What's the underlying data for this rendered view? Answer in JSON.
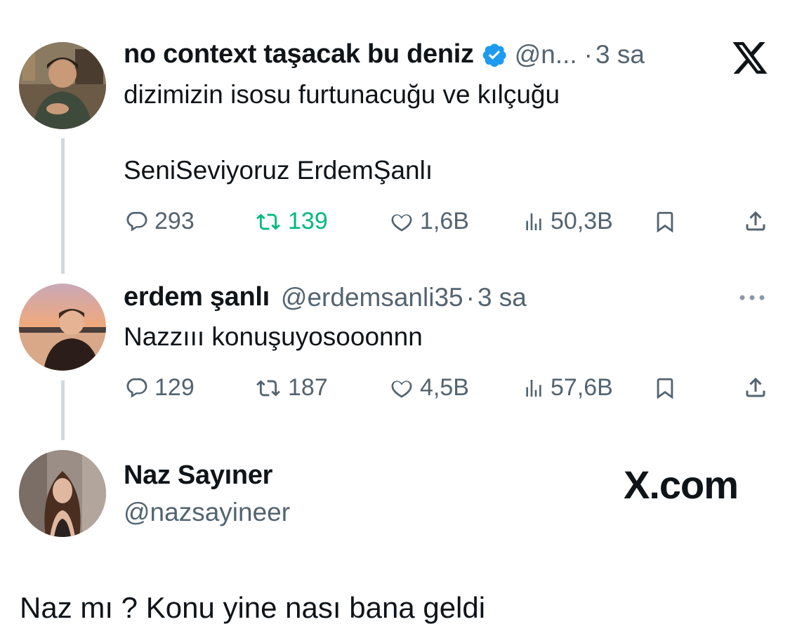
{
  "tweet1": {
    "author_name": "no context taşacak bu deniz",
    "handle": "@n...",
    "sep": "·",
    "time": "3 sa",
    "text_line1": "dizimizin isosu furtunacuğu ve kılçuğu",
    "text_line2": "SeniSeviyoruz ErdemŞanlı",
    "replies": "293",
    "reposts": "139",
    "likes": "1,6B",
    "views": "50,3B"
  },
  "tweet2": {
    "author_name": "erdem şanlı",
    "handle": "@erdemsanli35",
    "sep": "·",
    "time": "3 sa",
    "text": "Nazzııı konuşuyosooonnn",
    "replies": "129",
    "reposts": "187",
    "likes": "4,5B",
    "views": "57,6B"
  },
  "profile": {
    "name": "Naz Sayıner",
    "handle": "@nazsayineer",
    "watermark": "X.com"
  },
  "caption": "Naz mı ? Konu yine nası bana geldi",
  "colors": {
    "verified": "#1d9bf0",
    "repost_active": "#00ba7c",
    "muted": "#536471",
    "thread_line": "#cfd9de"
  },
  "icons": [
    "x-logo-icon",
    "verified-badge-icon",
    "reply-icon",
    "repost-icon",
    "like-icon",
    "views-icon",
    "bookmark-icon",
    "share-icon",
    "more-icon"
  ]
}
